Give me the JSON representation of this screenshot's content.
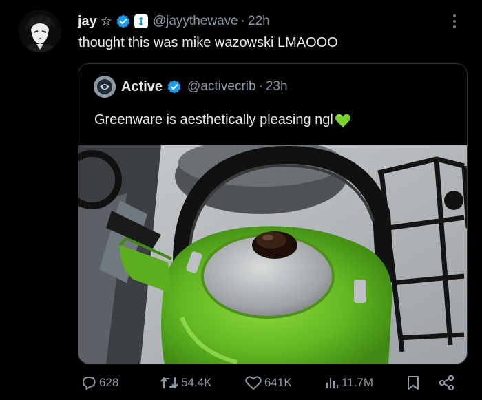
{
  "author": {
    "name": "jay",
    "star": "☆",
    "handle": "@jayythewave",
    "separator": "·",
    "time": "22h"
  },
  "tweet_text": "thought this was mike wazowski LMAOOO",
  "quoted": {
    "name": "Active",
    "handle": "@activecrib",
    "separator": "·",
    "time": "23h",
    "text": "Greenware is aesthetically pleasing ngl",
    "emoji": "green-heart",
    "media": "photo of a green kettle with a silver lid and black handle on a gas stove"
  },
  "actions": {
    "replies": "628",
    "retweets": "54.4K",
    "likes": "641K",
    "views": "11.7M"
  },
  "colors": {
    "background": "#000000",
    "text": "#e7e9ea",
    "muted": "#8b98a5",
    "border": "#2f3336",
    "verified": "#1d9bf0",
    "kettle": "#6cc02a"
  },
  "icons": [
    "more-icon",
    "star-icon",
    "verified-badge-icon",
    "affiliate-badge-icon",
    "reply-icon",
    "retweet-icon",
    "like-icon",
    "views-icon",
    "bookmark-icon",
    "share-icon"
  ]
}
